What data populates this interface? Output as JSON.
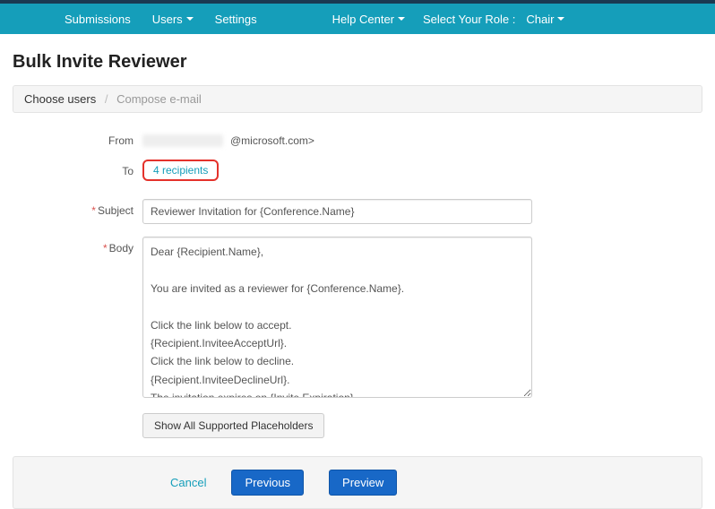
{
  "nav": {
    "submissions": "Submissions",
    "users": "Users",
    "settings": "Settings",
    "help_center": "Help Center",
    "role_label": "Select Your Role :",
    "role_value": "Chair"
  },
  "page_title": "Bulk Invite Reviewer",
  "breadcrumb": {
    "step1": "Choose users",
    "step2": "Compose e-mail"
  },
  "labels": {
    "from": "From",
    "to": "To",
    "subject": "Subject",
    "body": "Body"
  },
  "from_email_suffix": "@microsoft.com>",
  "to_recipients": "4 recipients",
  "subject_value": "Reviewer Invitation for {Conference.Name}",
  "body_value": "Dear {Recipient.Name},\n\nYou are invited as a reviewer for {Conference.Name}.\n\nClick the link below to accept.\n{Recipient.InviteeAcceptUrl}.\nClick the link below to decline.\n{Recipient.InviteeDeclineUrl}.\nThe invitation expires on {Invite.Expiration}.\n\nPlease contact {Sender.Email} if you have questions about the invitation.",
  "buttons": {
    "placeholders": "Show All Supported Placeholders",
    "cancel": "Cancel",
    "previous": "Previous",
    "preview": "Preview"
  }
}
